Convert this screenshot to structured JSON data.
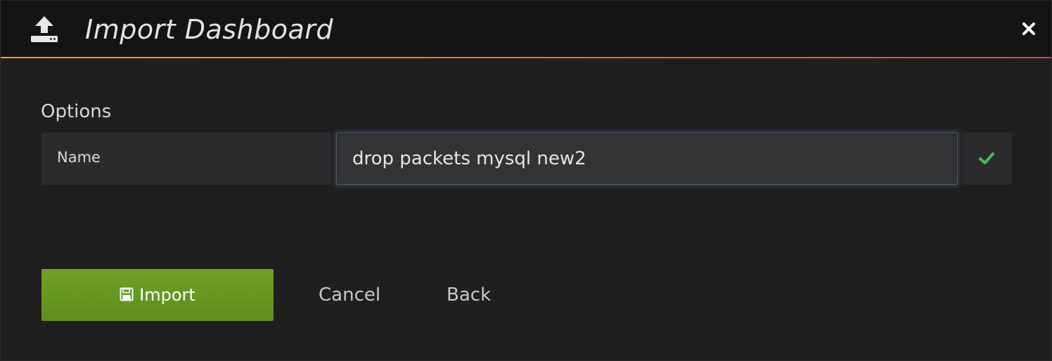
{
  "modal": {
    "title": "Import Dashboard",
    "header_icon": "upload-icon",
    "close_icon": "close-icon"
  },
  "options": {
    "section_title": "Options",
    "name_label": "Name",
    "name_value": "drop packets mysql new2",
    "status_icon": "check-icon",
    "status_color": "#3fbf52"
  },
  "actions": {
    "import_label": "Import",
    "import_icon": "save-icon",
    "cancel_label": "Cancel",
    "back_label": "Back"
  },
  "colors": {
    "accent_start": "#f7a30f",
    "accent_end": "#d44a3a",
    "import_button": "#6fa224"
  }
}
